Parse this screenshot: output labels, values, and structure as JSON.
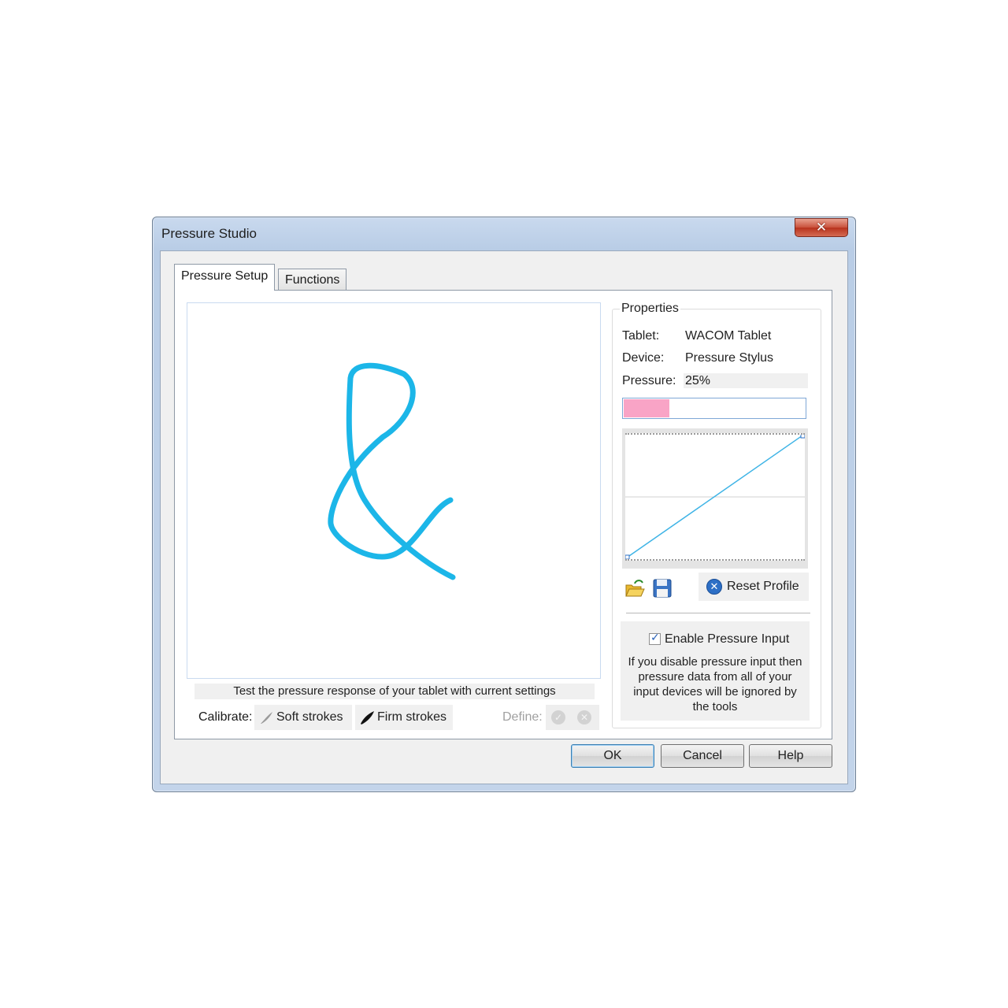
{
  "window": {
    "title": "Pressure Studio",
    "close_glyph": "✕"
  },
  "tabs": [
    {
      "label": "Pressure Setup",
      "active": true
    },
    {
      "label": "Functions",
      "active": false
    }
  ],
  "canvas": {
    "stroke_color": "#1cb6e8",
    "hint": "Test the pressure response of your tablet with current settings"
  },
  "calibrate": {
    "label": "Calibrate:",
    "soft_label": "Soft strokes",
    "firm_label": "Firm strokes",
    "define_label": "Define:"
  },
  "properties": {
    "title": "Properties",
    "tablet_label": "Tablet:",
    "tablet_value": "WACOM Tablet",
    "device_label": "Device:",
    "device_value": "Pressure Stylus",
    "pressure_label": "Pressure:",
    "pressure_value": "25%",
    "pressure_fraction": 0.25,
    "pressure_color": "#f9a4c6",
    "reset_label": "Reset Profile",
    "enable_label": "Enable Pressure Input",
    "enable_checked": true,
    "enable_desc": "If you disable pressure input then pressure data from all of your input devices will be ignored by the tools"
  },
  "buttons": {
    "ok": "OK",
    "cancel": "Cancel",
    "help": "Help"
  }
}
